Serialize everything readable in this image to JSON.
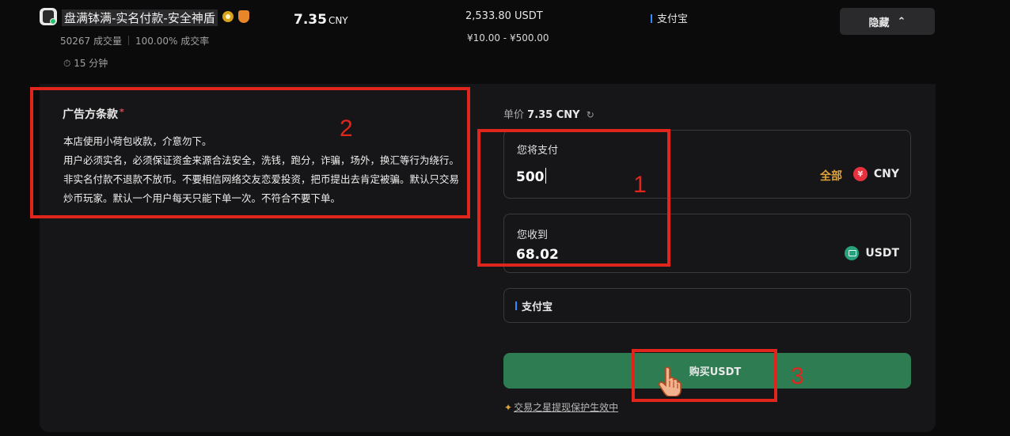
{
  "merchant": {
    "name": "盘满钵满-实名付款-安全神盾",
    "trades": "50267 成交量",
    "completion": "100.00% 成交率",
    "time": "15 分钟"
  },
  "offer": {
    "price": "7.35",
    "price_unit": "CNY",
    "available": "2,533.80 USDT",
    "limits": "¥10.00 - ¥500.00",
    "payment_method": "支付宝",
    "hide_label": "隐藏"
  },
  "terms": {
    "title": "广告方条款",
    "required_mark": "*",
    "body": "本店使用小荷包收款，介意勿下。\n用户必须实名，必须保证资金来源合法安全，洗钱，跑分，诈骗，场外，换汇等行为绕行。非实名付款不退款不放币。不要相信网络交友恋爱投资，把币提出去肯定被骗。默认只交易炒币玩家。默认一个用户每天只能下单一次。不符合不要下单。"
  },
  "order": {
    "unit_price_label": "单价",
    "unit_price_value": "7.35 CNY",
    "pay_label": "您将支付",
    "pay_value": "500",
    "all_label": "全部",
    "pay_currency": "CNY",
    "receive_label": "您收到",
    "receive_value": "68.02",
    "receive_currency": "USDT",
    "method_label": "支付宝",
    "buy_button": "购买USDT",
    "footnote": "交易之星提现保护生效中"
  },
  "annotations": [
    "1",
    "2",
    "3"
  ],
  "colors": {
    "buy_button": "#2e7d52",
    "annotation": "#e0261c",
    "accent_all": "#e0a23a"
  }
}
